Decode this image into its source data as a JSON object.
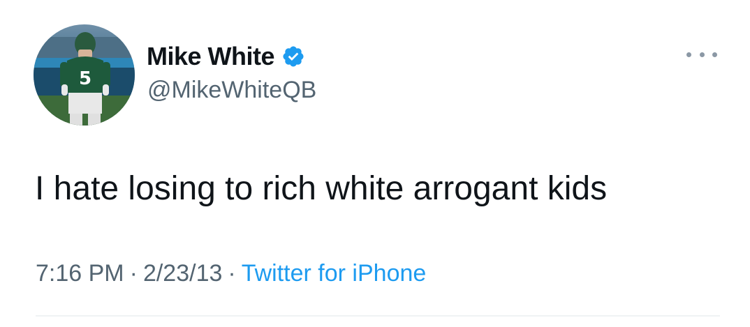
{
  "tweet": {
    "author": {
      "display_name": "Mike White",
      "handle": "@MikeWhiteQB",
      "verified": true,
      "avatar_icon": "avatar-photo",
      "jersey_number": "5"
    },
    "text": "I hate losing to rich white arrogant kids",
    "time": "7:16 PM",
    "date": "2/23/13",
    "separator": "·",
    "source": "Twitter for iPhone",
    "more_icon": "more-options-icon"
  },
  "colors": {
    "verified_blue": "#1d9bf0",
    "source_link": "#1d9bf0",
    "muted_text": "#536471",
    "primary_text": "#0f1419",
    "jersey_green": "#1e5a3c"
  }
}
